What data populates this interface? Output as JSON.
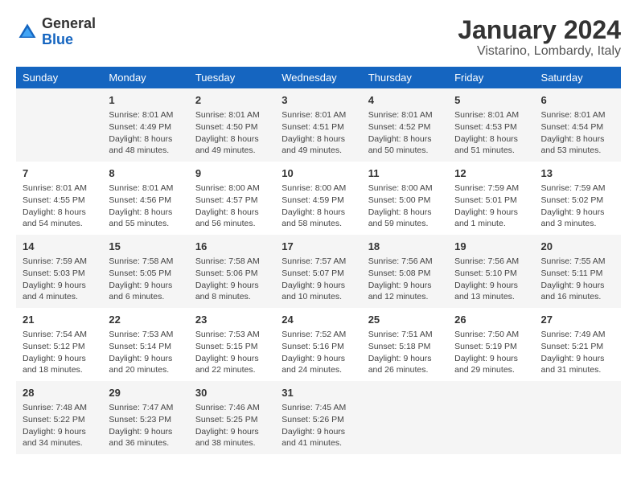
{
  "header": {
    "logo_general": "General",
    "logo_blue": "Blue",
    "title": "January 2024",
    "subtitle": "Vistarino, Lombardy, Italy"
  },
  "columns": [
    "Sunday",
    "Monday",
    "Tuesday",
    "Wednesday",
    "Thursday",
    "Friday",
    "Saturday"
  ],
  "weeks": [
    [
      {
        "day": "",
        "info": ""
      },
      {
        "day": "1",
        "info": "Sunrise: 8:01 AM\nSunset: 4:49 PM\nDaylight: 8 hours\nand 48 minutes."
      },
      {
        "day": "2",
        "info": "Sunrise: 8:01 AM\nSunset: 4:50 PM\nDaylight: 8 hours\nand 49 minutes."
      },
      {
        "day": "3",
        "info": "Sunrise: 8:01 AM\nSunset: 4:51 PM\nDaylight: 8 hours\nand 49 minutes."
      },
      {
        "day": "4",
        "info": "Sunrise: 8:01 AM\nSunset: 4:52 PM\nDaylight: 8 hours\nand 50 minutes."
      },
      {
        "day": "5",
        "info": "Sunrise: 8:01 AM\nSunset: 4:53 PM\nDaylight: 8 hours\nand 51 minutes."
      },
      {
        "day": "6",
        "info": "Sunrise: 8:01 AM\nSunset: 4:54 PM\nDaylight: 8 hours\nand 53 minutes."
      }
    ],
    [
      {
        "day": "7",
        "info": "Sunrise: 8:01 AM\nSunset: 4:55 PM\nDaylight: 8 hours\nand 54 minutes."
      },
      {
        "day": "8",
        "info": "Sunrise: 8:01 AM\nSunset: 4:56 PM\nDaylight: 8 hours\nand 55 minutes."
      },
      {
        "day": "9",
        "info": "Sunrise: 8:00 AM\nSunset: 4:57 PM\nDaylight: 8 hours\nand 56 minutes."
      },
      {
        "day": "10",
        "info": "Sunrise: 8:00 AM\nSunset: 4:59 PM\nDaylight: 8 hours\nand 58 minutes."
      },
      {
        "day": "11",
        "info": "Sunrise: 8:00 AM\nSunset: 5:00 PM\nDaylight: 8 hours\nand 59 minutes."
      },
      {
        "day": "12",
        "info": "Sunrise: 7:59 AM\nSunset: 5:01 PM\nDaylight: 9 hours\nand 1 minute."
      },
      {
        "day": "13",
        "info": "Sunrise: 7:59 AM\nSunset: 5:02 PM\nDaylight: 9 hours\nand 3 minutes."
      }
    ],
    [
      {
        "day": "14",
        "info": "Sunrise: 7:59 AM\nSunset: 5:03 PM\nDaylight: 9 hours\nand 4 minutes."
      },
      {
        "day": "15",
        "info": "Sunrise: 7:58 AM\nSunset: 5:05 PM\nDaylight: 9 hours\nand 6 minutes."
      },
      {
        "day": "16",
        "info": "Sunrise: 7:58 AM\nSunset: 5:06 PM\nDaylight: 9 hours\nand 8 minutes."
      },
      {
        "day": "17",
        "info": "Sunrise: 7:57 AM\nSunset: 5:07 PM\nDaylight: 9 hours\nand 10 minutes."
      },
      {
        "day": "18",
        "info": "Sunrise: 7:56 AM\nSunset: 5:08 PM\nDaylight: 9 hours\nand 12 minutes."
      },
      {
        "day": "19",
        "info": "Sunrise: 7:56 AM\nSunset: 5:10 PM\nDaylight: 9 hours\nand 13 minutes."
      },
      {
        "day": "20",
        "info": "Sunrise: 7:55 AM\nSunset: 5:11 PM\nDaylight: 9 hours\nand 16 minutes."
      }
    ],
    [
      {
        "day": "21",
        "info": "Sunrise: 7:54 AM\nSunset: 5:12 PM\nDaylight: 9 hours\nand 18 minutes."
      },
      {
        "day": "22",
        "info": "Sunrise: 7:53 AM\nSunset: 5:14 PM\nDaylight: 9 hours\nand 20 minutes."
      },
      {
        "day": "23",
        "info": "Sunrise: 7:53 AM\nSunset: 5:15 PM\nDaylight: 9 hours\nand 22 minutes."
      },
      {
        "day": "24",
        "info": "Sunrise: 7:52 AM\nSunset: 5:16 PM\nDaylight: 9 hours\nand 24 minutes."
      },
      {
        "day": "25",
        "info": "Sunrise: 7:51 AM\nSunset: 5:18 PM\nDaylight: 9 hours\nand 26 minutes."
      },
      {
        "day": "26",
        "info": "Sunrise: 7:50 AM\nSunset: 5:19 PM\nDaylight: 9 hours\nand 29 minutes."
      },
      {
        "day": "27",
        "info": "Sunrise: 7:49 AM\nSunset: 5:21 PM\nDaylight: 9 hours\nand 31 minutes."
      }
    ],
    [
      {
        "day": "28",
        "info": "Sunrise: 7:48 AM\nSunset: 5:22 PM\nDaylight: 9 hours\nand 34 minutes."
      },
      {
        "day": "29",
        "info": "Sunrise: 7:47 AM\nSunset: 5:23 PM\nDaylight: 9 hours\nand 36 minutes."
      },
      {
        "day": "30",
        "info": "Sunrise: 7:46 AM\nSunset: 5:25 PM\nDaylight: 9 hours\nand 38 minutes."
      },
      {
        "day": "31",
        "info": "Sunrise: 7:45 AM\nSunset: 5:26 PM\nDaylight: 9 hours\nand 41 minutes."
      },
      {
        "day": "",
        "info": ""
      },
      {
        "day": "",
        "info": ""
      },
      {
        "day": "",
        "info": ""
      }
    ]
  ]
}
